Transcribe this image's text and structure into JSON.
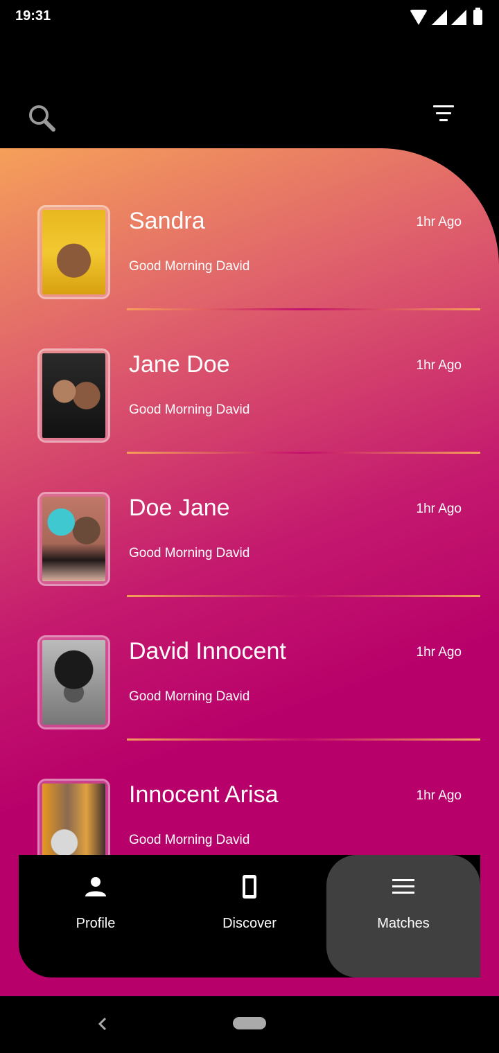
{
  "status_bar": {
    "time": "19:31"
  },
  "header": {
    "search_icon": "search-icon",
    "filter_icon": "filter-icon"
  },
  "matches": [
    {
      "name": "Sandra",
      "time": "1hr Ago",
      "message": "Good Morning David"
    },
    {
      "name": "Jane Doe",
      "time": "1hr Ago",
      "message": "Good Morning David"
    },
    {
      "name": "Doe Jane",
      "time": "1hr Ago",
      "message": "Good Morning David"
    },
    {
      "name": "David Innocent",
      "time": "1hr Ago",
      "message": "Good Morning David"
    },
    {
      "name": "Innocent Arisa",
      "time": "1hr Ago",
      "message": "Good Morning David"
    }
  ],
  "bottom_nav": {
    "items": [
      {
        "label": "Profile",
        "icon": "person-icon"
      },
      {
        "label": "Discover",
        "icon": "phone-icon"
      },
      {
        "label": "Matches",
        "icon": "menu-icon",
        "active": true
      }
    ]
  },
  "colors": {
    "gradient_top": "#f5a05a",
    "gradient_bottom": "#b8006a",
    "active_tab": "#404040",
    "nav_background": "#000000"
  }
}
